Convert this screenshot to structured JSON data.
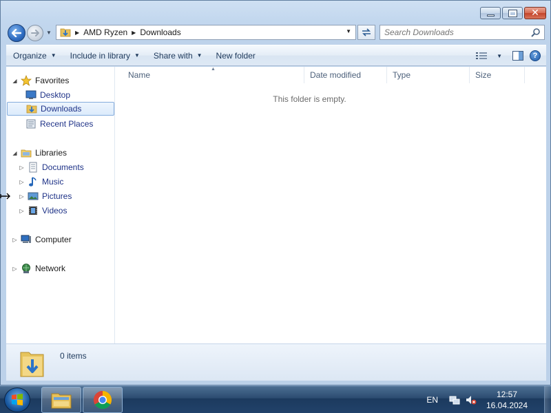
{
  "window": {
    "minimize_icon": "minimize-icon",
    "maximize_icon": "maximize-icon",
    "close_glyph": "✕"
  },
  "address": {
    "crumbs": [
      "AMD Ryzen",
      "Downloads"
    ],
    "search_placeholder": "Search Downloads"
  },
  "toolbar": {
    "organize": "Organize",
    "include_in_library": "Include in library",
    "share_with": "Share with",
    "new_folder": "New folder",
    "help": "?"
  },
  "nav": {
    "favorites": "Favorites",
    "desktop": "Desktop",
    "downloads": "Downloads",
    "recent_places": "Recent Places",
    "libraries": "Libraries",
    "documents": "Documents",
    "music": "Music",
    "pictures": "Pictures",
    "videos": "Videos",
    "computer": "Computer",
    "network": "Network"
  },
  "columns": {
    "name": "Name",
    "date_modified": "Date modified",
    "type": "Type",
    "size": "Size"
  },
  "content": {
    "empty_message": "This folder is empty."
  },
  "details": {
    "item_count": "0 items"
  },
  "taskbar": {
    "language": "EN",
    "time": "12:57",
    "date": "16.04.2024"
  },
  "colors": {
    "accent": "#1e395b",
    "link": "#1e3287",
    "taskbar": "#21426a"
  }
}
